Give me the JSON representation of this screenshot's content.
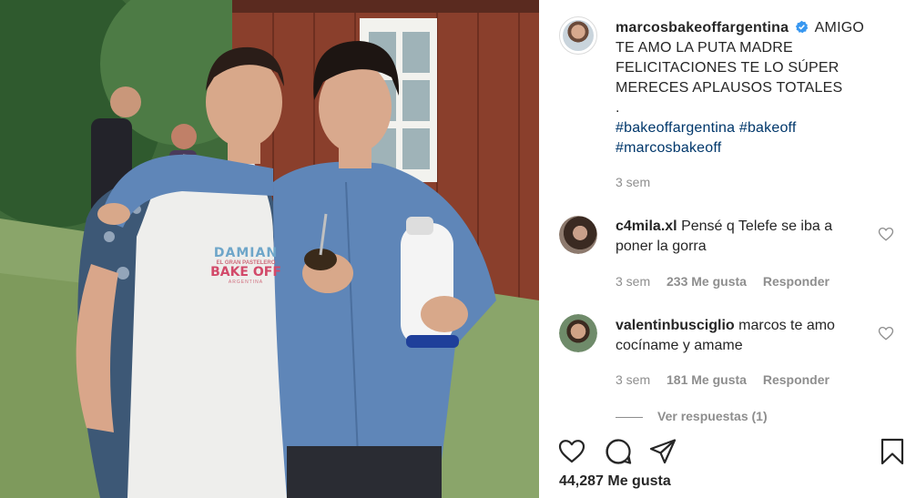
{
  "post": {
    "username": "marcosbakeoffargentina",
    "caption_lines": [
      "AMIGO",
      "TE AMO LA PUTA MADRE",
      "FELICITACIONES TE LO SÚPER",
      "MERECES APLAUSOS TOTALES",
      "."
    ],
    "hashtags_line1": "#bakeoffargentina #bakeoff",
    "hashtags_line2": "#marcosbakeoff",
    "time": "3 sem",
    "likes": "44,287 Me gusta"
  },
  "apron": {
    "name": "DAMIAN",
    "line1": "EL GRAN PASTELERO",
    "logo": "BAKE OFF",
    "line3": "ARGENTINA"
  },
  "comments": [
    {
      "username": "c4mila.xl",
      "text_line1": "Pensé q Telefe se iba a",
      "text_line2": "poner la gorra",
      "time": "3 sem",
      "likes": "233 Me gusta",
      "reply": "Responder"
    },
    {
      "username": "valentinbusciglio",
      "text_line1": "marcos te amo",
      "text_line2": "cocíname y amame",
      "time": "3 sem",
      "likes": "181 Me gusta",
      "reply": "Responder"
    }
  ],
  "view_replies": "Ver respuestas (1)",
  "icons": [
    "heart-icon",
    "comment-icon",
    "share-icon",
    "bookmark-icon",
    "verified-icon",
    "small-heart-icon"
  ],
  "colors": {
    "hashtag": "#00376b",
    "muted": "#8e8e8e",
    "verified": "#3897f0"
  }
}
